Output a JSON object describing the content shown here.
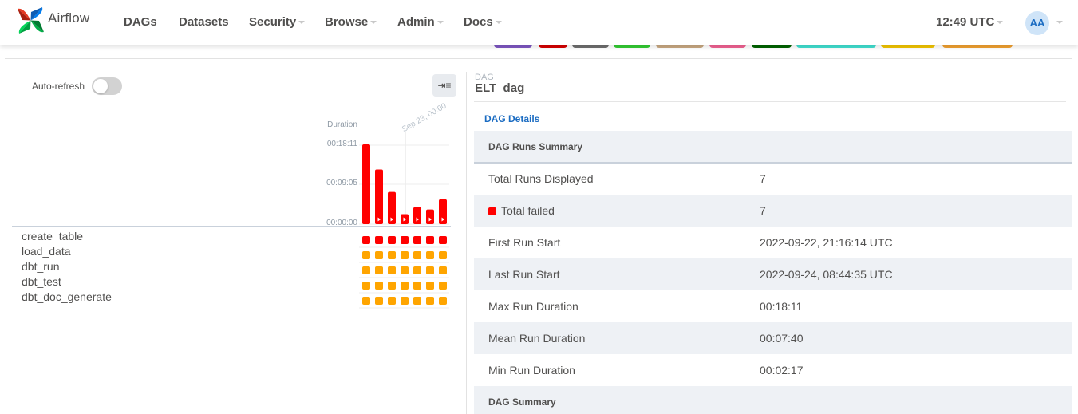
{
  "nav": {
    "brand": "Airflow",
    "items": [
      {
        "label": "DAGs",
        "dropdown": false
      },
      {
        "label": "Datasets",
        "dropdown": false
      },
      {
        "label": "Security",
        "dropdown": true
      },
      {
        "label": "Browse",
        "dropdown": true
      },
      {
        "label": "Admin",
        "dropdown": true
      },
      {
        "label": "Docs",
        "dropdown": true
      }
    ],
    "clock": "12:49 UTC",
    "avatar_initials": "AA"
  },
  "status_colors": [
    "#7e57c2",
    "#d50000",
    "#6e6e6e",
    "#33cc33",
    "#c8a882",
    "#f06292",
    "#006400",
    "#40e0d0",
    "#f2c500",
    "#f0a030"
  ],
  "grid": {
    "auto_refresh_label": "Auto-refresh",
    "auto_refresh_on": false,
    "collapse_icon": "collapse-sidebar-icon",
    "duration_label": "Duration",
    "date_label": "Sep 23, 00:00",
    "y_ticks": [
      "00:18:11",
      "00:09:05",
      "00:00:00"
    ],
    "max_seconds": 1091,
    "runs": [
      {
        "duration_seconds": 1091,
        "state": "failed",
        "color": "#ff0000"
      },
      {
        "duration_seconds": 748,
        "state": "failed",
        "color": "#ff0000"
      },
      {
        "duration_seconds": 440,
        "state": "failed",
        "color": "#ff0000"
      },
      {
        "duration_seconds": 137,
        "state": "failed",
        "color": "#ff0000"
      },
      {
        "duration_seconds": 232,
        "state": "failed",
        "color": "#ff0000"
      },
      {
        "duration_seconds": 200,
        "state": "failed",
        "color": "#ff0000"
      },
      {
        "duration_seconds": 340,
        "state": "failed",
        "color": "#ff0000"
      }
    ],
    "tasks": [
      {
        "name": "create_table",
        "color": "#ff0000"
      },
      {
        "name": "load_data",
        "color": "#ffa500"
      },
      {
        "name": "dbt_run",
        "color": "#ffa500"
      },
      {
        "name": "dbt_test",
        "color": "#ffa500"
      },
      {
        "name": "dbt_doc_generate",
        "color": "#ffa500"
      }
    ]
  },
  "details": {
    "dag_label": "DAG",
    "dag_id": "ELT_dag",
    "tab": "DAG Details",
    "runs_summary_title": "DAG Runs Summary",
    "rows": [
      {
        "key": "Total Runs Displayed",
        "value": "7"
      },
      {
        "key": "Total failed",
        "value": "7",
        "color": "#ff0000"
      },
      {
        "key": "First Run Start",
        "value": "2022-09-22, 21:16:14 UTC"
      },
      {
        "key": "Last Run Start",
        "value": "2022-09-24, 08:44:35 UTC"
      },
      {
        "key": "Max Run Duration",
        "value": "00:18:11"
      },
      {
        "key": "Mean Run Duration",
        "value": "00:07:40"
      },
      {
        "key": "Min Run Duration",
        "value": "00:02:17"
      }
    ],
    "dag_summary_title": "DAG Summary"
  }
}
